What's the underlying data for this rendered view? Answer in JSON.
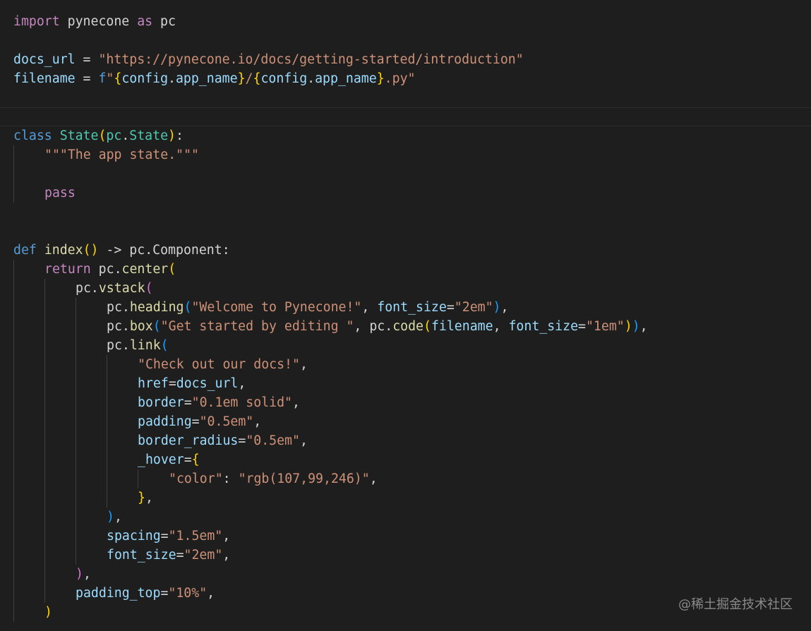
{
  "editor": {
    "background": "#1e1e1e",
    "watermark": "@稀土掘金技术社区"
  },
  "palette": {
    "kw": "#c586c0",
    "ctl": "#569cd6",
    "var": "#9cdcfe",
    "fn": "#dcdcaa",
    "cls": "#4ec9b0",
    "str": "#ce9178",
    "plain": "#d4d4d4",
    "b1": "#ffd700",
    "b2": "#da70d6",
    "b3": "#179fff"
  },
  "lines": [
    {
      "indent": 0,
      "tokens": [
        [
          "import",
          "kw"
        ],
        [
          " pynecone ",
          "plain"
        ],
        [
          "as",
          "kw"
        ],
        [
          " pc",
          "plain"
        ]
      ]
    },
    {
      "indent": 0,
      "tokens": []
    },
    {
      "indent": 0,
      "tokens": [
        [
          "docs_url",
          "var"
        ],
        [
          " = ",
          "plain"
        ],
        [
          "\"https://pynecone.io/docs/getting-started/introduction\"",
          "str"
        ]
      ]
    },
    {
      "indent": 0,
      "tokens": [
        [
          "filename",
          "var"
        ],
        [
          " = ",
          "plain"
        ],
        [
          "f",
          "ctl"
        ],
        [
          "\"",
          "str"
        ],
        [
          "{",
          "b1"
        ],
        [
          "config",
          "var"
        ],
        [
          ".",
          "plain"
        ],
        [
          "app_name",
          "var"
        ],
        [
          "}",
          "b1"
        ],
        [
          "/",
          "str"
        ],
        [
          "{",
          "b1"
        ],
        [
          "config",
          "var"
        ],
        [
          ".",
          "plain"
        ],
        [
          "app_name",
          "var"
        ],
        [
          "}",
          "b1"
        ],
        [
          ".py\"",
          "str"
        ]
      ]
    },
    {
      "indent": 0,
      "tokens": []
    },
    {
      "indent": 0,
      "current": true,
      "tokens": []
    },
    {
      "indent": 0,
      "tokens": [
        [
          "class",
          "ctl"
        ],
        [
          " ",
          "plain"
        ],
        [
          "State",
          "cls"
        ],
        [
          "(",
          "b1"
        ],
        [
          "pc",
          "cls"
        ],
        [
          ".",
          "plain"
        ],
        [
          "State",
          "cls"
        ],
        [
          ")",
          "b1"
        ],
        [
          ":",
          "plain"
        ]
      ]
    },
    {
      "indent": 1,
      "tokens": [
        [
          "\"\"\"The app state.\"\"\"",
          "str"
        ]
      ]
    },
    {
      "indent": 1,
      "tokens": []
    },
    {
      "indent": 1,
      "tokens": [
        [
          "pass",
          "kw"
        ]
      ]
    },
    {
      "indent": 0,
      "tokens": []
    },
    {
      "indent": 0,
      "tokens": []
    },
    {
      "indent": 0,
      "tokens": [
        [
          "def",
          "ctl"
        ],
        [
          " ",
          "plain"
        ],
        [
          "index",
          "fn"
        ],
        [
          "(",
          "b1"
        ],
        [
          ")",
          "b1"
        ],
        [
          " -> ",
          "plain"
        ],
        [
          "pc",
          "plain"
        ],
        [
          ".",
          "plain"
        ],
        [
          "Component",
          "plain"
        ],
        [
          ":",
          "plain"
        ]
      ]
    },
    {
      "indent": 1,
      "tokens": [
        [
          "return",
          "kw"
        ],
        [
          " pc",
          "plain"
        ],
        [
          ".",
          "plain"
        ],
        [
          "center",
          "fn"
        ],
        [
          "(",
          "b1"
        ]
      ]
    },
    {
      "indent": 2,
      "tokens": [
        [
          "pc",
          "plain"
        ],
        [
          ".",
          "plain"
        ],
        [
          "vstack",
          "fn"
        ],
        [
          "(",
          "b2"
        ]
      ]
    },
    {
      "indent": 3,
      "tokens": [
        [
          "pc",
          "plain"
        ],
        [
          ".",
          "plain"
        ],
        [
          "heading",
          "fn"
        ],
        [
          "(",
          "b3"
        ],
        [
          "\"Welcome to Pynecone!\"",
          "str"
        ],
        [
          ", ",
          "plain"
        ],
        [
          "font_size",
          "var"
        ],
        [
          "=",
          "plain"
        ],
        [
          "\"2em\"",
          "str"
        ],
        [
          ")",
          "b3"
        ],
        [
          ",",
          "plain"
        ]
      ]
    },
    {
      "indent": 3,
      "tokens": [
        [
          "pc",
          "plain"
        ],
        [
          ".",
          "plain"
        ],
        [
          "box",
          "fn"
        ],
        [
          "(",
          "b3"
        ],
        [
          "\"Get started by editing \"",
          "str"
        ],
        [
          ", ",
          "plain"
        ],
        [
          "pc",
          "plain"
        ],
        [
          ".",
          "plain"
        ],
        [
          "code",
          "fn"
        ],
        [
          "(",
          "b1"
        ],
        [
          "filename",
          "var"
        ],
        [
          ", ",
          "plain"
        ],
        [
          "font_size",
          "var"
        ],
        [
          "=",
          "plain"
        ],
        [
          "\"1em\"",
          "str"
        ],
        [
          ")",
          "b1"
        ],
        [
          ")",
          "b3"
        ],
        [
          ",",
          "plain"
        ]
      ]
    },
    {
      "indent": 3,
      "tokens": [
        [
          "pc",
          "plain"
        ],
        [
          ".",
          "plain"
        ],
        [
          "link",
          "fn"
        ],
        [
          "(",
          "b3"
        ]
      ]
    },
    {
      "indent": 4,
      "tokens": [
        [
          "\"Check out our docs!\"",
          "str"
        ],
        [
          ",",
          "plain"
        ]
      ]
    },
    {
      "indent": 4,
      "tokens": [
        [
          "href",
          "var"
        ],
        [
          "=",
          "plain"
        ],
        [
          "docs_url",
          "var"
        ],
        [
          ",",
          "plain"
        ]
      ]
    },
    {
      "indent": 4,
      "tokens": [
        [
          "border",
          "var"
        ],
        [
          "=",
          "plain"
        ],
        [
          "\"0.1em solid\"",
          "str"
        ],
        [
          ",",
          "plain"
        ]
      ]
    },
    {
      "indent": 4,
      "tokens": [
        [
          "padding",
          "var"
        ],
        [
          "=",
          "plain"
        ],
        [
          "\"0.5em\"",
          "str"
        ],
        [
          ",",
          "plain"
        ]
      ]
    },
    {
      "indent": 4,
      "tokens": [
        [
          "border_radius",
          "var"
        ],
        [
          "=",
          "plain"
        ],
        [
          "\"0.5em\"",
          "str"
        ],
        [
          ",",
          "plain"
        ]
      ]
    },
    {
      "indent": 4,
      "tokens": [
        [
          "_hover",
          "var"
        ],
        [
          "=",
          "plain"
        ],
        [
          "{",
          "b1"
        ]
      ]
    },
    {
      "indent": 5,
      "tokens": [
        [
          "\"color\"",
          "str"
        ],
        [
          ": ",
          "plain"
        ],
        [
          "\"rgb(107,99,246)\"",
          "str"
        ],
        [
          ",",
          "plain"
        ]
      ]
    },
    {
      "indent": 4,
      "tokens": [
        [
          "}",
          "b1"
        ],
        [
          ",",
          "plain"
        ]
      ]
    },
    {
      "indent": 3,
      "tokens": [
        [
          ")",
          "b3"
        ],
        [
          ",",
          "plain"
        ]
      ]
    },
    {
      "indent": 3,
      "tokens": [
        [
          "spacing",
          "var"
        ],
        [
          "=",
          "plain"
        ],
        [
          "\"1.5em\"",
          "str"
        ],
        [
          ",",
          "plain"
        ]
      ]
    },
    {
      "indent": 3,
      "tokens": [
        [
          "font_size",
          "var"
        ],
        [
          "=",
          "plain"
        ],
        [
          "\"2em\"",
          "str"
        ],
        [
          ",",
          "plain"
        ]
      ]
    },
    {
      "indent": 2,
      "tokens": [
        [
          ")",
          "b2"
        ],
        [
          ",",
          "plain"
        ]
      ]
    },
    {
      "indent": 2,
      "tokens": [
        [
          "padding_top",
          "var"
        ],
        [
          "=",
          "plain"
        ],
        [
          "\"10%\"",
          "str"
        ],
        [
          ",",
          "plain"
        ]
      ]
    },
    {
      "indent": 1,
      "tokens": [
        [
          ")",
          "b1"
        ]
      ]
    }
  ]
}
